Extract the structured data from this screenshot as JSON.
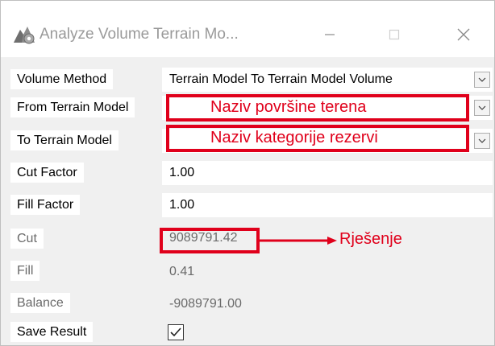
{
  "window": {
    "title": "Analyze Volume Terrain Mo...",
    "app_icon": "terrain-gear-icon",
    "controls": {
      "minimize": "minimize-icon",
      "maximize": "maximize-icon",
      "close": "close-icon"
    }
  },
  "form": {
    "volume_method": {
      "label": "Volume Method",
      "value": "Terrain Model To Terrain Model Volume"
    },
    "from_terrain": {
      "label": "From Terrain Model",
      "value": ""
    },
    "to_terrain": {
      "label": "To Terrain Model",
      "value": ""
    },
    "cut_factor": {
      "label": "Cut Factor",
      "value": "1.00"
    },
    "fill_factor": {
      "label": "Fill Factor",
      "value": "1.00"
    },
    "cut": {
      "label": "Cut",
      "value": "9089791.42"
    },
    "fill": {
      "label": "Fill",
      "value": "0.41"
    },
    "balance": {
      "label": "Balance",
      "value": "-9089791.00"
    },
    "save_result": {
      "label": "Save Result",
      "checked": true
    }
  },
  "annotations": {
    "from_terrain_note": "Naziv površine terena",
    "to_terrain_note": "Naziv kategorije rezervi",
    "result_note": "Rješenje",
    "color": "#e0001b"
  }
}
